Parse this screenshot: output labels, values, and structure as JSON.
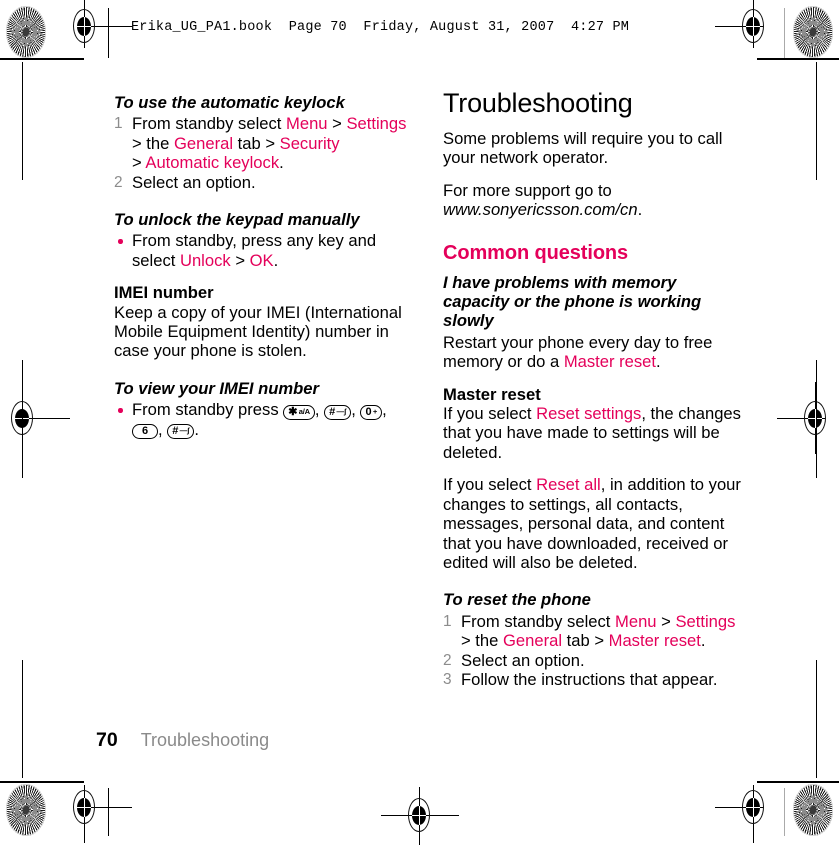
{
  "slug": {
    "text": "Erika_UG_PA1.book  Page 70  Friday, August 31, 2007  4:27 PM"
  },
  "accent_color": "#E4005A",
  "left_column": {
    "task_keylock": {
      "heading": "To use the automatic keylock",
      "step1": {
        "part1": "From standby select ",
        "ui_menu": "Menu",
        "sep1": " > ",
        "ui_settings": "Settings",
        "part2": "> the ",
        "ui_general": "General",
        "part3": " tab > ",
        "ui_security": "Security",
        "part4": "> ",
        "ui_auto_keylock": "Automatic keylock",
        "period": "."
      },
      "step2": "Select an option."
    },
    "task_unlock": {
      "heading": "To unlock the keypad manually",
      "bullet": {
        "part1": "From standby, press any key and select ",
        "ui_unlock": "Unlock",
        "sep": " > ",
        "ui_ok": "OK",
        "period": "."
      }
    },
    "imei_section": {
      "heading": "IMEI number",
      "body": "Keep a copy of your IMEI (International Mobile Equipment Identity) number in case your phone is stolen."
    },
    "task_imei": {
      "heading": "To view your IMEI number",
      "bullet_lead": "From standby press ",
      "keys": [
        {
          "name": "star-key",
          "main": "✱",
          "sub": "a/A"
        },
        {
          "name": "hash-key",
          "main": "#",
          "sub": "—ʃ"
        },
        {
          "name": "zero-key",
          "main": "0",
          "sub": "+"
        },
        {
          "name": "six-key",
          "main": "6",
          "sub": ""
        },
        {
          "name": "hash-key",
          "main": "#",
          "sub": "—ʃ"
        }
      ],
      "comma": ", ",
      "period": "."
    }
  },
  "right_column": {
    "chapter_title": "Troubleshooting",
    "intro_1": "Some problems will require you to call your network operator.",
    "intro_2": {
      "lead": "For more support go to ",
      "url": "www.sonyericsson.com/cn",
      "period": "."
    },
    "common_questions_heading": "Common questions",
    "memory_question": {
      "heading": "I have problems with memory capacity or the phone is working slowly",
      "body_part1": "Restart your phone every day to free memory or do a ",
      "ui_master_reset": "Master reset",
      "period": "."
    },
    "master_reset": {
      "heading": "Master reset",
      "para1_part1": "If you select ",
      "ui_reset_settings": "Reset settings",
      "para1_part2": ", the changes that you have made to settings will be deleted.",
      "para2_part1": "If you select ",
      "ui_reset_all": "Reset all",
      "para2_part2": ", in addition to your changes to settings, all contacts, messages, personal data, and content that you have downloaded, received or edited will also be deleted."
    },
    "task_reset": {
      "heading": "To reset the phone",
      "step1": {
        "part1": "From standby select ",
        "ui_menu": "Menu",
        "sep1": " > ",
        "ui_settings": "Settings",
        "part2": "> the ",
        "ui_general": "General",
        "part3": " tab > ",
        "ui_master_reset": "Master reset",
        "period": "."
      },
      "step2": "Select an option.",
      "step3": "Follow the instructions that appear."
    }
  },
  "footer": {
    "page_number": "70",
    "chapter": "Troubleshooting"
  }
}
